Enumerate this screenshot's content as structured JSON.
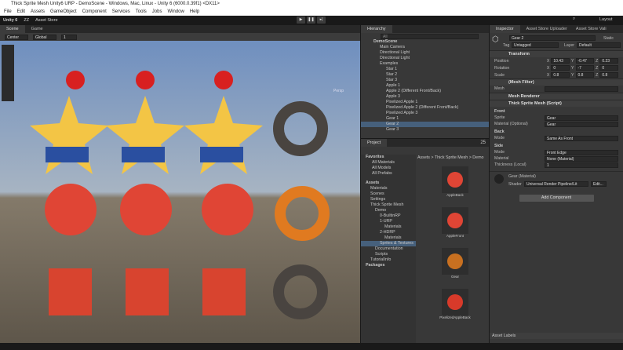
{
  "window": {
    "title": "Thick Sprite Mesh Unity6 URP - DemoScene - Windows, Mac, Linux - Unity 6 (6000.0.39f1) <DX11>"
  },
  "menu": [
    "File",
    "Edit",
    "Assets",
    "GameObject",
    "Component",
    "Services",
    "Tools",
    "Jobs",
    "Window",
    "Help"
  ],
  "toolbar": {
    "unity": "Unity 6",
    "account": "ZZ",
    "asset_store": "Asset Store",
    "layout": "Layout"
  },
  "scene": {
    "tabs": [
      "Scene",
      "Game"
    ],
    "pivot": "Center",
    "space": "Global",
    "grid": "1",
    "persp": "Persp"
  },
  "hierarchy": {
    "title": "Hierarchy",
    "search": "All",
    "scene": "DemoScene",
    "items": [
      {
        "label": "Main Camera",
        "depth": 1
      },
      {
        "label": "Directional Light",
        "depth": 1
      },
      {
        "label": "Directional Light",
        "depth": 1
      },
      {
        "label": "Examples",
        "depth": 1
      },
      {
        "label": "Star 1",
        "depth": 2
      },
      {
        "label": "Star 2",
        "depth": 2
      },
      {
        "label": "Star 3",
        "depth": 2
      },
      {
        "label": "Apple 1",
        "depth": 2
      },
      {
        "label": "Apple 2 (Different Front/Back)",
        "depth": 2
      },
      {
        "label": "Apple 3",
        "depth": 2
      },
      {
        "label": "Pixelized Apple 1",
        "depth": 2
      },
      {
        "label": "Pixelized Apple 2 (Different Front/Back)",
        "depth": 2
      },
      {
        "label": "Pixelized Apple 3",
        "depth": 2
      },
      {
        "label": "Gear 1",
        "depth": 2
      },
      {
        "label": "Gear 2",
        "depth": 2,
        "selected": true
      },
      {
        "label": "Gear 3",
        "depth": 2
      }
    ]
  },
  "project": {
    "title": "Project",
    "count": "25",
    "breadcrumb": [
      "Assets",
      "Thick Sprite Mesh",
      "Demo"
    ],
    "favorites": {
      "label": "Favorites",
      "items": [
        "All Materials",
        "All Models",
        "All Prefabs"
      ]
    },
    "tree": [
      {
        "label": "Assets",
        "depth": 0,
        "bold": true
      },
      {
        "label": "Materials",
        "depth": 1
      },
      {
        "label": "Scenes",
        "depth": 1
      },
      {
        "label": "Settings",
        "depth": 1
      },
      {
        "label": "Thick Sprite Mesh",
        "depth": 1
      },
      {
        "label": "Demo",
        "depth": 2
      },
      {
        "label": "0-BuiltinRP",
        "depth": 3
      },
      {
        "label": "1-URP",
        "depth": 3
      },
      {
        "label": "Materials",
        "depth": 4
      },
      {
        "label": "2-HDRP",
        "depth": 3
      },
      {
        "label": "Materials",
        "depth": 4
      },
      {
        "label": "Sprites & Textures",
        "depth": 3,
        "selected": true
      },
      {
        "label": "Documentation",
        "depth": 2
      },
      {
        "label": "Scripts",
        "depth": 2
      },
      {
        "label": "TutorialInfo",
        "depth": 1
      },
      {
        "label": "Packages",
        "depth": 0,
        "bold": true
      }
    ],
    "assets": [
      "AppleBack",
      "AppleFront",
      "Gear",
      "PixelizedAppleBack"
    ]
  },
  "inspector": {
    "tabs": [
      "Inspector",
      "Asset Store Uploader",
      "Asset Store Vali"
    ],
    "name": "Gear 2",
    "static": "Static",
    "tag_label": "Tag",
    "tag": "Untagged",
    "layer_label": "Layer",
    "layer": "Default",
    "transform": {
      "title": "Transform",
      "position": {
        "label": "Position",
        "x": "10.43",
        "y": "-0.47",
        "z": "0.23"
      },
      "rotation": {
        "label": "Rotation",
        "x": "0",
        "y": "-7",
        "z": "0"
      },
      "scale": {
        "label": "Scale",
        "x": "0.8",
        "y": "0.8",
        "z": "0.8"
      }
    },
    "mesh_filter": {
      "title": "(Mesh Filter)",
      "mesh_label": "Mesh"
    },
    "mesh_renderer": {
      "title": "Mesh Renderer"
    },
    "thick": {
      "title": "Thick Sprite Mesh (Script)",
      "front": "Front",
      "sprite_label": "Sprite",
      "sprite": "Gear",
      "material_label": "Material (Optional)",
      "material": "Gear",
      "back": "Back",
      "back_mode_label": "Mode",
      "back_mode": "Same As Front",
      "side": "Side",
      "side_mode_label": "Mode",
      "side_mode": "Front Edge",
      "side_material_label": "Material",
      "side_material": "None (Material)",
      "thickness_label": "Thickness (Local)",
      "thickness": "1"
    },
    "material": {
      "name": "Gear (Material)",
      "shader_label": "Shader",
      "shader": "Universal Render Pipeline/Lit",
      "edit": "Edit..."
    },
    "add_component": "Add Component",
    "asset_labels": "Asset Labels"
  },
  "colors": {
    "selection": "#46607c",
    "sky": "#7f9cc6",
    "ground": "#746a5c"
  }
}
